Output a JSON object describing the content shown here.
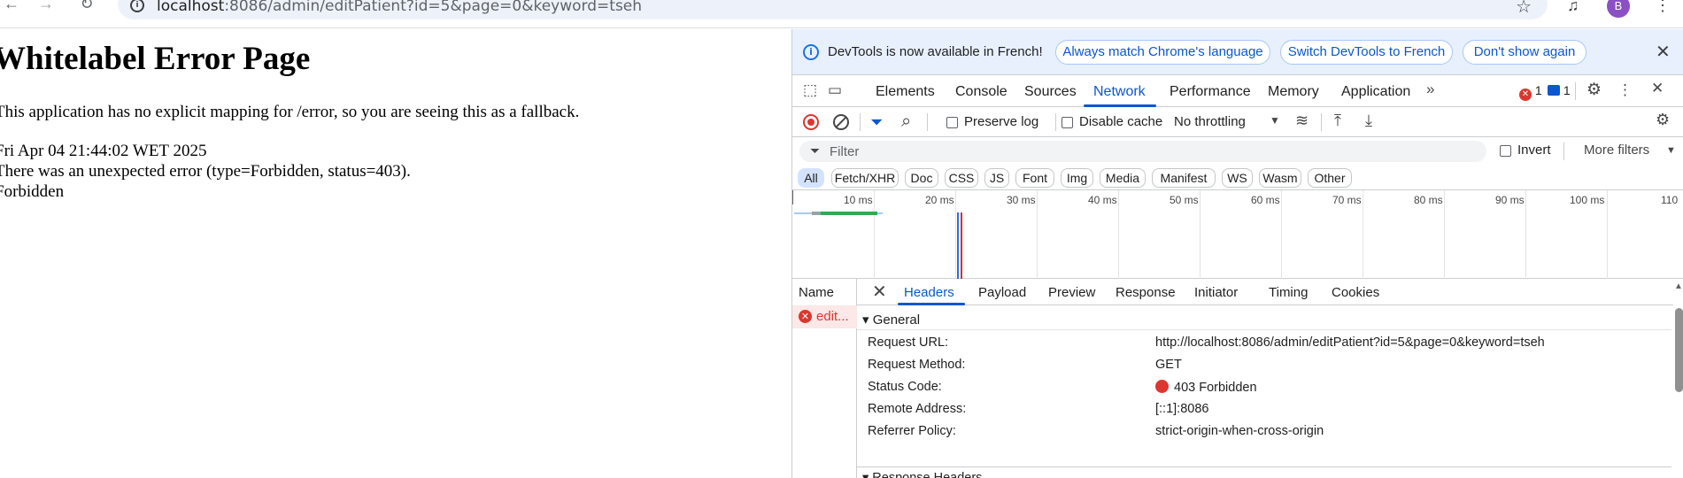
{
  "browser": {
    "url_host": "localhost",
    "url_path": ":8086/admin/editPatient?id=5&page=0&keyword=tseh",
    "avatar_letter": "B"
  },
  "page": {
    "title": "Whitelabel Error Page",
    "line1": "This application has no explicit mapping for /error, so you are seeing this as a fallback.",
    "line2": "Fri Apr 04 21:44:02 WET 2025",
    "line3": "There was an unexpected error (type=Forbidden, status=403).",
    "line4": "Forbidden"
  },
  "devtools": {
    "infobar": {
      "message": "DevTools is now available in French!",
      "btn_match": "Always match Chrome's language",
      "btn_switch": "Switch DevTools to French",
      "btn_dismiss": "Don't show again"
    },
    "tabs": [
      "Elements",
      "Console",
      "Sources",
      "Network",
      "Performance",
      "Memory",
      "Application"
    ],
    "active_tab": "Network",
    "error_count": "1",
    "message_count": "1",
    "toolbar": {
      "preserve_log": "Preserve log",
      "disable_cache": "Disable cache",
      "throttling": "No throttling"
    },
    "filter": {
      "placeholder": "Filter",
      "invert": "Invert",
      "more_filters": "More filters"
    },
    "type_filters": [
      "All",
      "Fetch/XHR",
      "Doc",
      "CSS",
      "JS",
      "Font",
      "Img",
      "Media",
      "Manifest",
      "WS",
      "Wasm",
      "Other"
    ],
    "overview_ticks": [
      "10 ms",
      "20 ms",
      "30 ms",
      "40 ms",
      "50 ms",
      "60 ms",
      "70 ms",
      "80 ms",
      "90 ms",
      "100 ms",
      "110"
    ],
    "requests": {
      "column": "Name",
      "rows": [
        {
          "name": "edit..."
        }
      ]
    },
    "detail_tabs": [
      "Headers",
      "Payload",
      "Preview",
      "Response",
      "Initiator",
      "Timing",
      "Cookies"
    ],
    "general": {
      "heading": "▾ General",
      "rows": [
        {
          "key": "Request URL:",
          "value": "http://localhost:8086/admin/editPatient?id=5&page=0&keyword=tseh"
        },
        {
          "key": "Request Method:",
          "value": "GET"
        },
        {
          "key": "Status Code:",
          "value": "403 Forbidden"
        },
        {
          "key": "Remote Address:",
          "value": "[::1]:8086"
        },
        {
          "key": "Referrer Policy:",
          "value": "strict-origin-when-cross-origin"
        }
      ]
    },
    "response_headers_label": "▾ Response Headers"
  },
  "colors": {
    "accent": "#0b57d0",
    "error": "#dc362e",
    "infobar_bg": "#e8f0fe"
  }
}
